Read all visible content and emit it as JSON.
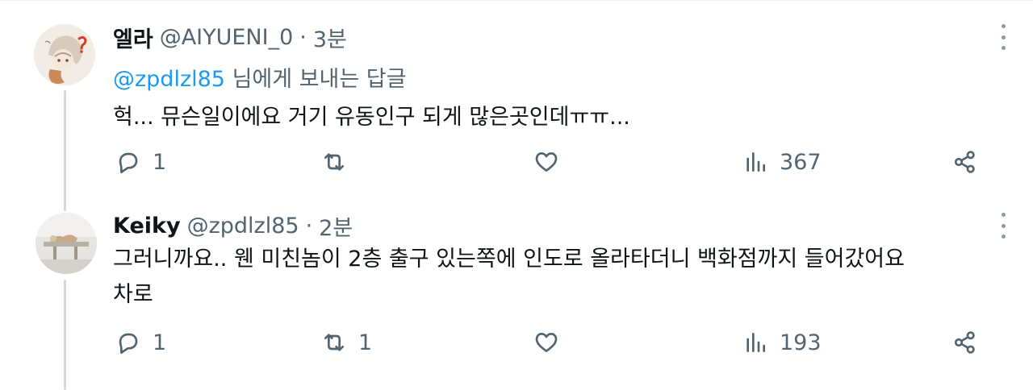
{
  "tweets": [
    {
      "name": "엘라",
      "handle": "@AIYUENI_0",
      "separator": "·",
      "time": "3분",
      "reply_to": {
        "mention": "@zpdlzl85",
        "suffix": " 님에게 보내는 답글"
      },
      "text": "헉... 뮤슨일이에요 거기 유동인구 되게 많은곳인데ㅠㅠ...",
      "counts": {
        "replies": "1",
        "retweets": "",
        "likes": "",
        "views": "367"
      }
    },
    {
      "name": "Keiky",
      "handle": "@zpdlzl85",
      "separator": "·",
      "time": "2분",
      "text_line1": "그러니까요.. 웬 미친놈이 2층 출구 있는쪽에 인도로 올라타더니 백화점까지 들어갔어요",
      "text_line2": "차로",
      "counts": {
        "replies": "1",
        "retweets": "1",
        "likes": "",
        "views": "193"
      }
    }
  ],
  "icons": [
    "reply-icon",
    "retweet-icon",
    "like-icon",
    "views-icon",
    "share-icon",
    "more-icon"
  ],
  "colors": {
    "accent": "#1d9bf0",
    "muted": "#536471",
    "text": "#0f1419",
    "thread_line": "#cfd9de"
  }
}
